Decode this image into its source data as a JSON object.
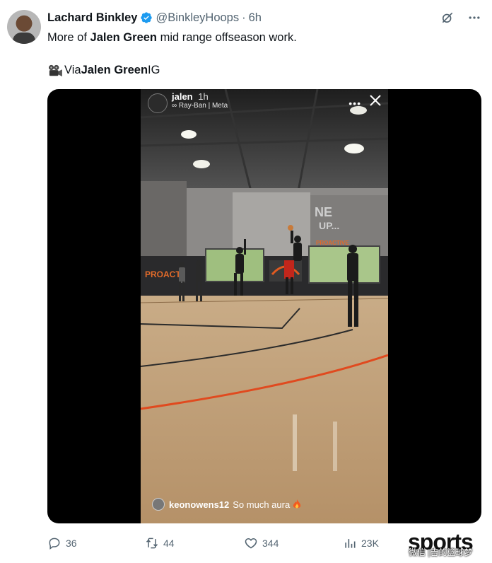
{
  "author": {
    "name": "Lachard Binkley",
    "handle": "@BinkleyHoops",
    "separator": "·",
    "time": "6h",
    "avatar_icon": "person-avatar",
    "verified_icon": "verified-badge-icon",
    "verified_color": "#1d9bf0"
  },
  "tweet": {
    "line1_prefix": "More of ",
    "line1_bold": "Jalen Green",
    "line1_suffix": " mid range offseason work.",
    "via_icon": "movie-camera-emoji",
    "via_prefix": "Via ",
    "via_bold": "Jalen Green",
    "via_suffix": " IG"
  },
  "top_actions": {
    "grok_icon": "grok-icon",
    "more_icon": "more-horizontal-icon"
  },
  "story": {
    "user": "jalen",
    "ago": "1h",
    "subtitle": "∞ Ray-Ban | Meta",
    "dots": "•••",
    "close_icon": "close-icon",
    "comment_user": "keonowens12",
    "comment_text": "So much aura",
    "comment_emoji": "fire-emoji"
  },
  "actions": {
    "replies": "36",
    "reposts": "44",
    "likes": "344",
    "views": "23K"
  },
  "watermark": {
    "text": "sports",
    "sub": "微信 |吉的篮球梦"
  },
  "colors": {
    "text": "#0f1419",
    "muted": "#536471",
    "court_orange": "#e04a1f"
  }
}
